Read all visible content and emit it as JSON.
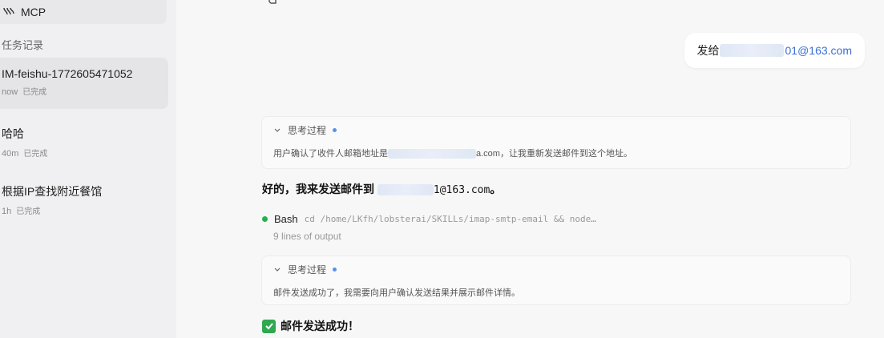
{
  "sidebar": {
    "mcp_label": "MCP",
    "section_title": "任务记录",
    "tasks": [
      {
        "title": "IM-feishu-1772605471052",
        "time": "now",
        "status": "已完成"
      },
      {
        "title": "哈哈",
        "time": "40m",
        "status": "已完成"
      },
      {
        "title": "根据IP查找附近餐馆",
        "time": "1h",
        "status": "已完成"
      }
    ]
  },
  "chat": {
    "user_message_prefix": "发给",
    "user_message_email_suffix": "01@163.com",
    "think1": {
      "title": "思考过程",
      "text_prefix": "用户确认了收件人邮箱地址是",
      "text_suffix": "a.com，让我重新发送邮件到这个地址。"
    },
    "reply_prefix": "好的，我来发送邮件到",
    "reply_email_suffix": "1@163.com",
    "reply_end": "。",
    "bash": {
      "label": "Bash",
      "command": "cd /home/LKfh/lobsterai/SKILLs/imap-smtp-email && node…",
      "output": "9 lines of output"
    },
    "think2": {
      "title": "思考过程",
      "text": "邮件发送成功了，我需要向用户确认发送结果并展示邮件详情。"
    },
    "success_text": "邮件发送成功！"
  }
}
